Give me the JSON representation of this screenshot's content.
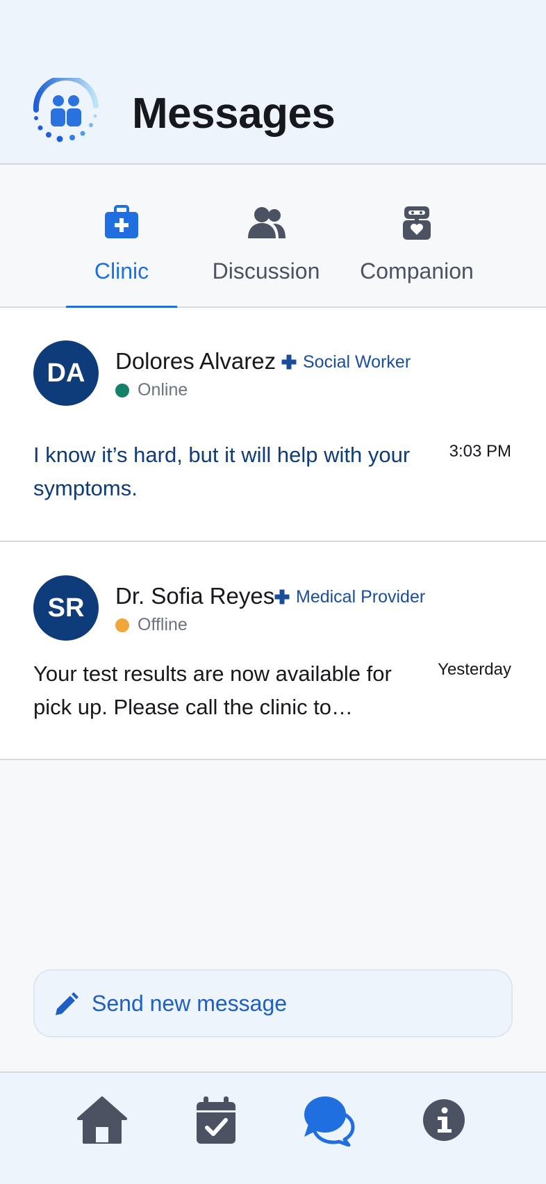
{
  "header": {
    "title": "Messages"
  },
  "tabs": [
    {
      "label": "Clinic",
      "icon": "medical-kit-icon",
      "active": true
    },
    {
      "label": "Discussion",
      "icon": "users-icon",
      "active": false
    },
    {
      "label": "Companion",
      "icon": "robot-heart-icon",
      "active": false
    }
  ],
  "messages": [
    {
      "initials": "DA",
      "name": "Dolores Alvarez",
      "role": "Social Worker",
      "status": "Online",
      "status_color": "#14806a",
      "time": "3:03 PM",
      "preview": "I know it’s hard, but it will help with your symptoms.",
      "unread": true,
      "text_color": "#0e3b7a"
    },
    {
      "initials": "SR",
      "name": "Dr. Sofia Reyes",
      "role": "Medical Provider",
      "status": "Offline",
      "status_color": "#f0a63a",
      "time": "Yesterday",
      "preview": "Your test results are now available for pick up. Please call the clinic to…",
      "unread": false,
      "text_color": "#16181d"
    }
  ],
  "compose": {
    "label": "Send new message",
    "icon": "pencil-icon"
  },
  "bottom_nav": [
    {
      "icon": "home-icon",
      "active": false
    },
    {
      "icon": "calendar-check-icon",
      "active": false
    },
    {
      "icon": "chat-bubbles-icon",
      "active": true
    },
    {
      "icon": "info-icon",
      "active": false
    }
  ],
  "colors": {
    "accent": "#1f6fe0",
    "navy": "#0e3b7a",
    "icon_gray": "#4b5261",
    "online": "#14806a",
    "offline": "#f0a63a"
  }
}
